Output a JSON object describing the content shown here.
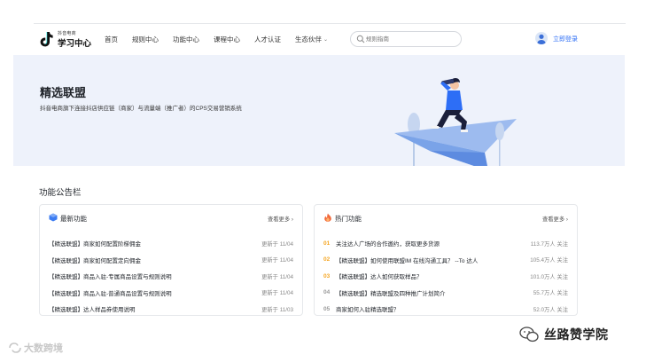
{
  "header": {
    "logo_small": "抖音电商",
    "logo_big": "学习中心",
    "nav": [
      "首页",
      "规则中心",
      "功能中心",
      "课程中心",
      "人才认证",
      "生态伙伴"
    ],
    "search_placeholder": "规则指南",
    "login": "立即登录"
  },
  "banner": {
    "title": "精选联盟",
    "subtitle": "抖音电商旗下连接抖店供应链（商家）与流量端（推广者）的CPS交易营销系统"
  },
  "section_title": "功能公告栏",
  "latest": {
    "title": "最新功能",
    "more": "查看更多 ›",
    "items": [
      {
        "text": "【精选联盟】商家如何配置阶梯佣金",
        "meta": "更新于 11/04"
      },
      {
        "text": "【精选联盟】商家如何配置定向佣金",
        "meta": "更新于 11/04"
      },
      {
        "text": "【精选联盟】商品入驻-专属商品设置与规则说明",
        "meta": "更新于 11/04"
      },
      {
        "text": "【精选联盟】商品入驻-普通商品设置与规则说明",
        "meta": "更新于 11/04"
      },
      {
        "text": "【精选联盟】达人样品券使用说明",
        "meta": "更新于 11/03"
      }
    ]
  },
  "hot": {
    "title": "热门功能",
    "more": "查看更多 ›",
    "items": [
      {
        "rank": "01",
        "text": "关注达人广场的合作邀约，获取更多货源",
        "meta": "113.7万人 关注"
      },
      {
        "rank": "02",
        "text": "【精选联盟】如何使用联盟IM 在线沟通工具？ --To 达人",
        "meta": "105.4万人 关注"
      },
      {
        "rank": "03",
        "text": "【精选联盟】达人如何获取样品？",
        "meta": "101.0万人 关注"
      },
      {
        "rank": "04",
        "text": "【精选联盟】精选联盟及四种推广计划简介",
        "meta": "55.7万人 关注"
      },
      {
        "rank": "05",
        "text": "商家如何入驻精选联盟？",
        "meta": "52.0万人 关注"
      }
    ]
  },
  "colors": {
    "accent": "#2d6ef6",
    "rank_top": "#f5a623",
    "rank_rest": "#999999",
    "banner_bg": "#eef2fb"
  },
  "watermarks": {
    "left": "大数跨境",
    "right": "丝路赞学院"
  }
}
